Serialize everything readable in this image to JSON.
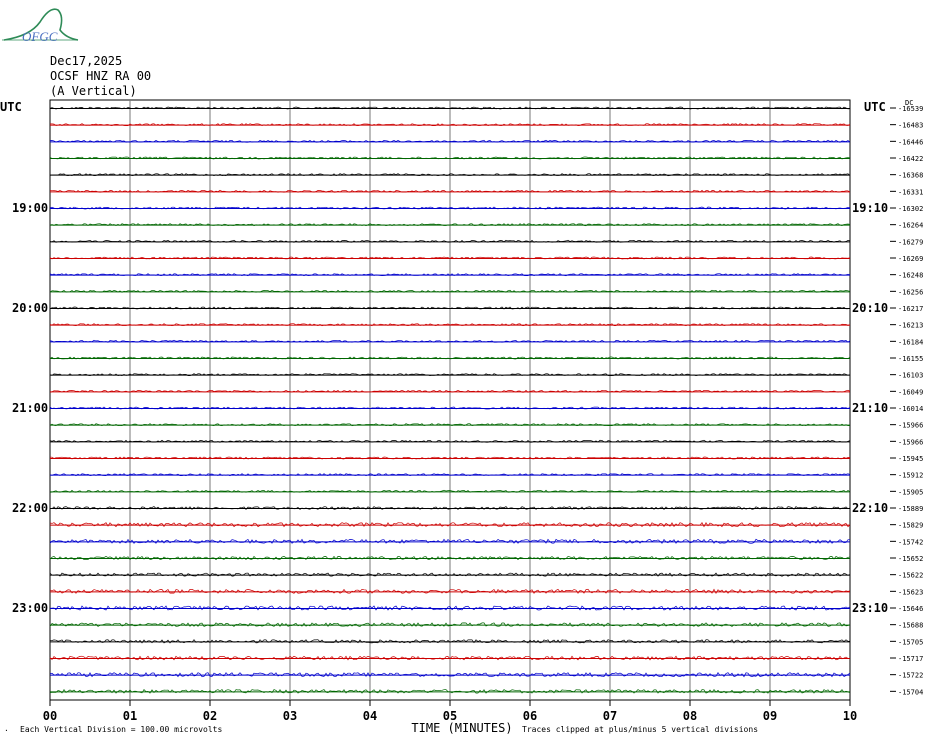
{
  "logo": {
    "text": "OFGC"
  },
  "header": {
    "date": "Dec17,2025",
    "station": "OCSF HNZ RA 00",
    "component": "(A Vertical)"
  },
  "chart_data": {
    "type": "line",
    "title": "Dec17,2025",
    "left_axis_label": "UTC",
    "right_axis_label": "UTC",
    "dc_label": "DC",
    "xlabel": "TIME (MINUTES)",
    "x_ticks": [
      "00",
      "01",
      "02",
      "03",
      "04",
      "05",
      "06",
      "07",
      "08",
      "09",
      "10"
    ],
    "xlim": [
      0,
      10
    ],
    "trace_colors": [
      "#000000",
      "#cc0000",
      "#0000cc",
      "#006600"
    ],
    "left_time_labels": [
      {
        "row": 6,
        "label": "19:00"
      },
      {
        "row": 12,
        "label": "20:00"
      },
      {
        "row": 18,
        "label": "21:00"
      },
      {
        "row": 24,
        "label": "22:00"
      },
      {
        "row": 30,
        "label": "23:00"
      }
    ],
    "right_time_labels": [
      {
        "row": 6,
        "label": "19:10"
      },
      {
        "row": 12,
        "label": "20:10"
      },
      {
        "row": 18,
        "label": "21:10"
      },
      {
        "row": 24,
        "label": "22:10"
      },
      {
        "row": 30,
        "label": "23:10"
      }
    ],
    "dc_offsets": [
      -16539,
      -16483,
      -16446,
      -16422,
      -16368,
      -16331,
      -16302,
      -16264,
      -16279,
      -16269,
      -16248,
      -16256,
      -16217,
      -16213,
      -16184,
      -16155,
      -16103,
      -16049,
      -16014,
      -15966,
      -15966,
      -15945,
      -15912,
      -15905,
      -15889,
      -15829,
      -15742,
      -15652,
      -15622,
      -15623,
      -15646,
      -15688,
      -15705,
      -15717,
      -15722,
      -15704
    ],
    "noise_levels": [
      1,
      1,
      1,
      1,
      1,
      1,
      1,
      1,
      1,
      1,
      1,
      1,
      1,
      1,
      1,
      1,
      1,
      1,
      1,
      1,
      1,
      1,
      1,
      1,
      1.4,
      2,
      2,
      1.6,
      1.6,
      2,
      2,
      1.8,
      1.6,
      1.8,
      2,
      1.8
    ],
    "footer_left": "Each Vertical Division =  100.00 microvolts",
    "footer_right": "Traces clipped at plus/minus 5 vertical divisions"
  }
}
